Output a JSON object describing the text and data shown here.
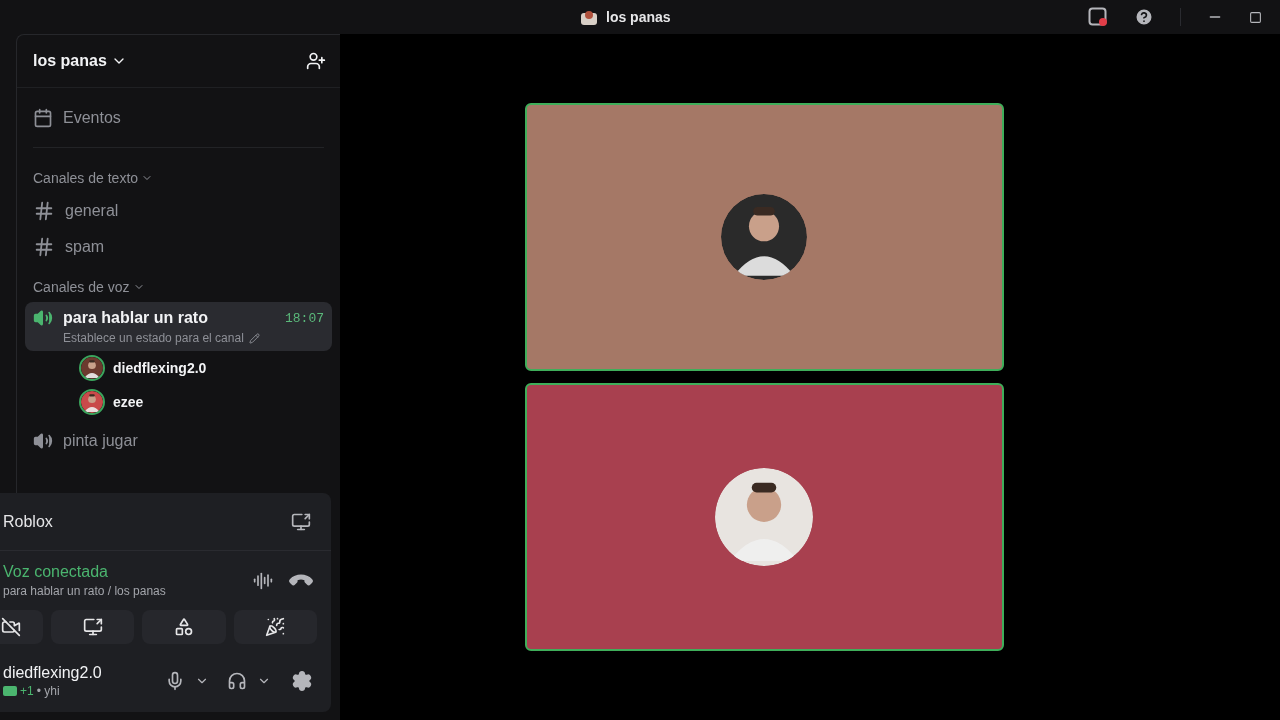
{
  "title_bar": {
    "title": "los panas"
  },
  "server": {
    "name": "los panas"
  },
  "events": {
    "label": "Eventos"
  },
  "categories": [
    {
      "label": "Canales de texto",
      "expanded": true,
      "channels": [
        {
          "kind": "text",
          "name": "general",
          "selected": false
        },
        {
          "kind": "text",
          "name": "spam",
          "selected": false
        }
      ]
    },
    {
      "label": "Canales de voz",
      "expanded": true,
      "channels": [
        {
          "kind": "voice",
          "name": "para hablar un rato",
          "selected": true,
          "connected": true,
          "timer": "18:07",
          "status_hint": "Establece un estado para el canal",
          "members": [
            {
              "name": "diedflexing2.0",
              "speaking": true
            },
            {
              "name": "ezee",
              "speaking": true
            }
          ]
        },
        {
          "kind": "voice",
          "name": "pinta jugar",
          "selected": false,
          "connected": false
        }
      ]
    }
  ],
  "activity": {
    "name": "Roblox"
  },
  "voice_connection": {
    "status": "Voz conectada",
    "location": "para hablar un rato / los panas"
  },
  "action_buttons": [
    {
      "kind": "camera"
    },
    {
      "kind": "screen"
    },
    {
      "kind": "activities"
    },
    {
      "kind": "soundboard"
    }
  ],
  "user": {
    "name": "diedflexing2.0",
    "game_count": "+1",
    "status": "• yhi"
  },
  "tiles": [
    {
      "color": "#a57866",
      "speaking": true
    },
    {
      "color": "#a8404f",
      "speaking": true
    }
  ]
}
